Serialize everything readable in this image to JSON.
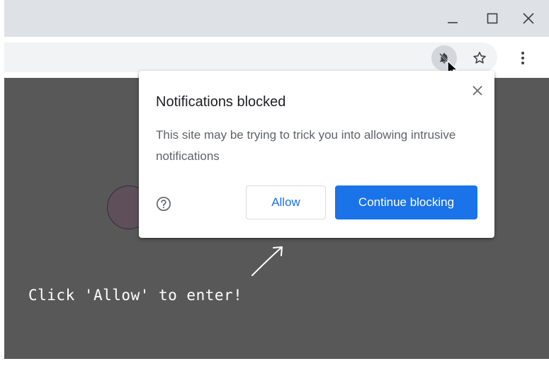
{
  "window": {
    "controls": [
      "minimize",
      "maximize",
      "close"
    ]
  },
  "toolbar": {
    "icons": [
      "notifications-blocked-icon",
      "bookmark-star-icon",
      "more-menu-icon"
    ]
  },
  "popup": {
    "title": "Notifications blocked",
    "body": "This site may be trying to trick you into allowing intrusive notifications",
    "allow_label": "Allow",
    "block_label": "Continue blocking"
  },
  "page": {
    "hint": "Click 'Allow' to enter!"
  },
  "colors": {
    "accent": "#1a73e8",
    "titlebar": "#dee1e6",
    "page_background": "#585858"
  }
}
